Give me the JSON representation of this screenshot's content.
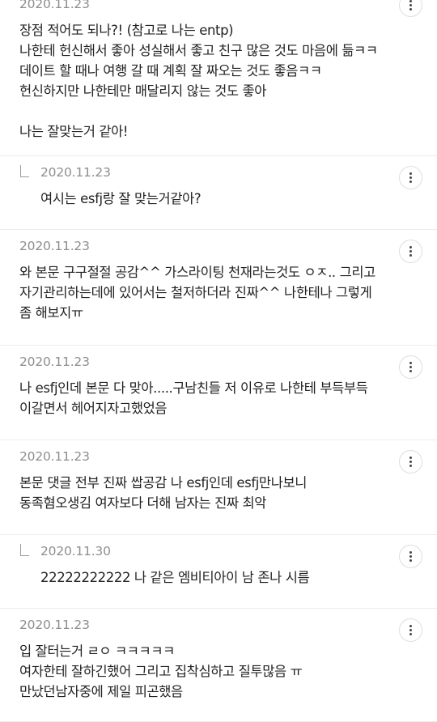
{
  "comments": [
    {
      "date": "2020.11.23",
      "body": "장점 적어도 되나?! (참고로 나는 entp)\n나한테 헌신해서 좋아 성실해서 좋고 친구 많은 것도 마음에 듦ㅋㅋ\n데이트 할 때나 여행 갈 때 계획 잘 짜오는 것도 좋음ㅋㅋ\n헌신하지만 나한테만 매달리지 않는 것도 좋아\n\n나는 잘맞는거 같아!"
    },
    {
      "date": "2020.11.23",
      "body": "여시는 esfj랑 잘 맞는거같아?"
    },
    {
      "date": "2020.11.23",
      "body": "와 본문 구구절절 공감^^ 가스라이팅 천재라는것도 ㅇㅈ.. 그리고\n자기관리하는데에 있어서는 철저하더라 진짜^^ 나한테나 그렇게\n좀 해보지ㅠ"
    },
    {
      "date": "2020.11.23",
      "body": "나 esfj인데 본문 다 맞아.....구남친들 저 이유로 나한테 부득부득\n이갈면서 헤어지자고했었음"
    },
    {
      "date": "2020.11.23",
      "body": "본문 댓글 전부 진짜 쌉공감 나 esfj인데 esfj만나보니\n동족혐오생김 여자보다 더해 남자는 진짜 최악"
    },
    {
      "date": "2020.11.30",
      "body": "22222222222 나 같은 엠비티아이 남 존나 시름"
    },
    {
      "date": "2020.11.23",
      "body": "입 잘터는거 ㄹㅇ ㅋㅋㅋㅋㅋ\n여자한테 잘하긴했어 그리고 집착심하고 질투많음 ㅠ\n만났던남자중에 제일 피곤했음"
    }
  ]
}
